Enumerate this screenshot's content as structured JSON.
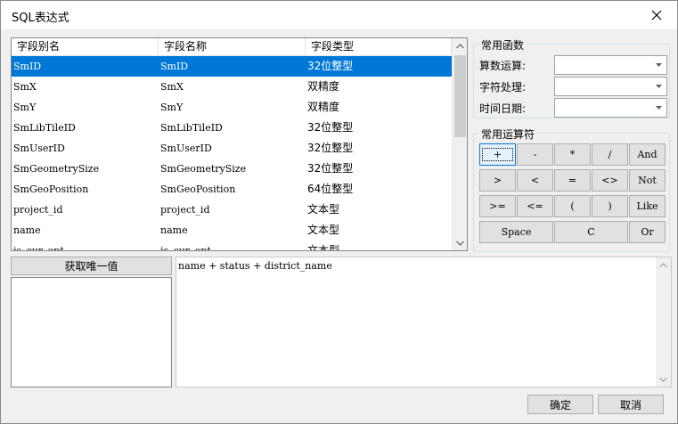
{
  "window": {
    "title": "SQL表达式"
  },
  "fields": {
    "columns": [
      "字段别名",
      "字段名称",
      "字段类型"
    ],
    "rows": [
      [
        "SmID",
        "SmID",
        "32位整型"
      ],
      [
        "SmX",
        "SmX",
        "双精度"
      ],
      [
        "SmY",
        "SmY",
        "双精度"
      ],
      [
        "SmLibTileID",
        "SmLibTileID",
        "32位整型"
      ],
      [
        "SmUserID",
        "SmUserID",
        "32位整型"
      ],
      [
        "SmGeometrySize",
        "SmGeometrySize",
        "32位整型"
      ],
      [
        "SmGeoPosition",
        "SmGeoPosition",
        "64位整型"
      ],
      [
        "project_id",
        "project_id",
        "文本型"
      ],
      [
        "name",
        "name",
        "文本型"
      ],
      [
        "is_cur_opt",
        "is_cur_opt",
        "文本型"
      ]
    ],
    "selected_index": 0
  },
  "functions": {
    "title": "常用函数",
    "items": [
      {
        "label": "算数运算:",
        "value": ""
      },
      {
        "label": "字符处理:",
        "value": ""
      },
      {
        "label": "时间日期:",
        "value": ""
      }
    ]
  },
  "operators": {
    "title": "常用运算符",
    "rows": [
      [
        "+",
        "-",
        "*",
        "/",
        "And"
      ],
      [
        ">",
        "<",
        "=",
        "<>",
        "Not"
      ],
      [
        ">=",
        "<=",
        "(",
        ")",
        "Like"
      ]
    ],
    "bottom": [
      "Space",
      "C",
      "Or"
    ]
  },
  "unique_values": {
    "button_label": "获取唯一值"
  },
  "expression": {
    "text": "name + status + district_name"
  },
  "footer": {
    "ok_label": "确定",
    "cancel_label": "取消"
  }
}
